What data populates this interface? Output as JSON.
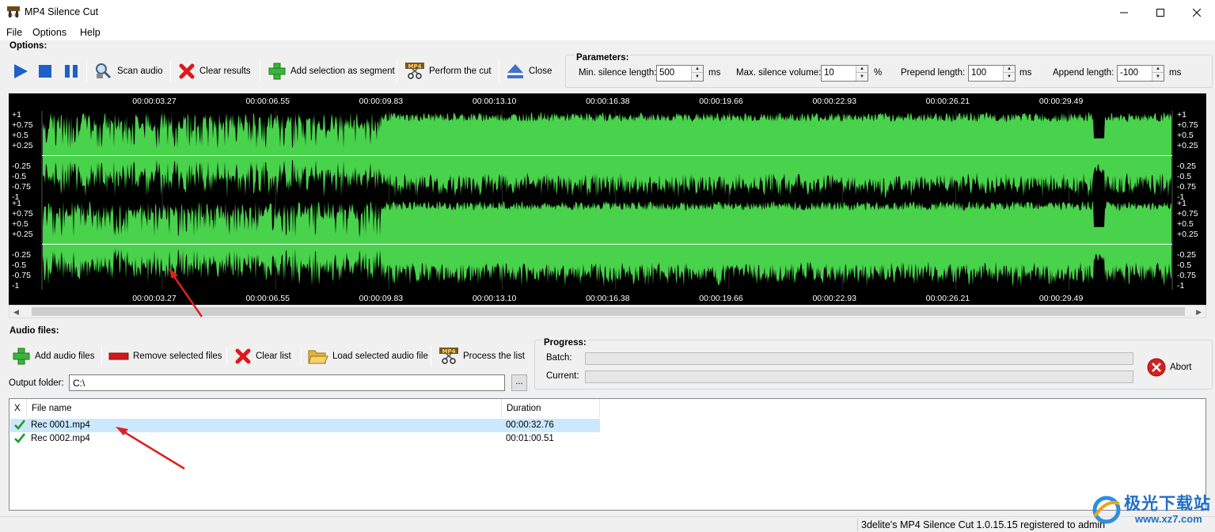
{
  "window": {
    "title": "MP4 Silence Cut",
    "controls": [
      "minimize-icon",
      "maximize-icon",
      "close-icon"
    ]
  },
  "menu": [
    "File",
    "Options",
    "Help"
  ],
  "options": {
    "label": "Options:",
    "buttons": {
      "play": "play-icon",
      "stop": "stop-icon",
      "pause": "pause-icon",
      "scan": "Scan audio",
      "clear_results": "Clear results",
      "add_segment": "Add selection as segment",
      "perform_cut": "Perform the cut",
      "close": "Close"
    }
  },
  "parameters": {
    "label": "Parameters:",
    "min_silence": {
      "label": "Min. silence length:",
      "value": "500",
      "unit": "ms"
    },
    "max_volume": {
      "label": "Max. silence volume:",
      "value": "10",
      "unit": "%"
    },
    "prepend": {
      "label": "Prepend length:",
      "value": "100",
      "unit": "ms"
    },
    "append": {
      "label": "Append length:",
      "value": "-100",
      "unit": "ms"
    }
  },
  "waveform": {
    "time_labels": [
      "00:00:03.27",
      "00:00:06.55",
      "00:00:09.83",
      "00:00:13.10",
      "00:00:16.38",
      "00:00:19.66",
      "00:00:22.93",
      "00:00:26.21",
      "00:00:29.49"
    ],
    "amp_labels_top": [
      "+1",
      "+0.75",
      "+0.5",
      "+0.25",
      "-0.25",
      "-0.5",
      "-0.75",
      "-1"
    ],
    "amp_labels_bottom": [
      "+1",
      "+0.75",
      "+0.5",
      "+0.25",
      "-0.25",
      "-0.5",
      "-0.75",
      "-1"
    ],
    "wave_color": "#49d24c",
    "background": "#000000"
  },
  "audio_files": {
    "label": "Audio files:",
    "buttons": {
      "add": "Add audio files",
      "remove": "Remove selected files",
      "clear": "Clear list",
      "load": "Load selected audio file",
      "process": "Process the list"
    },
    "output_folder_label": "Output folder:",
    "output_folder_value": "C:\\",
    "browse": "..."
  },
  "progress": {
    "label": "Progress:",
    "batch_label": "Batch:",
    "current_label": "Current:",
    "batch_value": 0,
    "current_value": 0,
    "abort": "Abort"
  },
  "file_list": {
    "columns": [
      "X",
      "File name",
      "Duration"
    ],
    "rows": [
      {
        "name": "Rec 0001.mp4",
        "duration": "00:00:32.76",
        "checked": true,
        "selected": true
      },
      {
        "name": "Rec 0002.mp4",
        "duration": "00:01:00.51",
        "checked": true,
        "selected": false
      }
    ]
  },
  "status": "3delite's MP4 Silence Cut 1.0.15.15 registered to admin",
  "watermark": {
    "text1": "极光下载站",
    "text2": "www.xz7.com"
  },
  "accent_color": "#e02020"
}
